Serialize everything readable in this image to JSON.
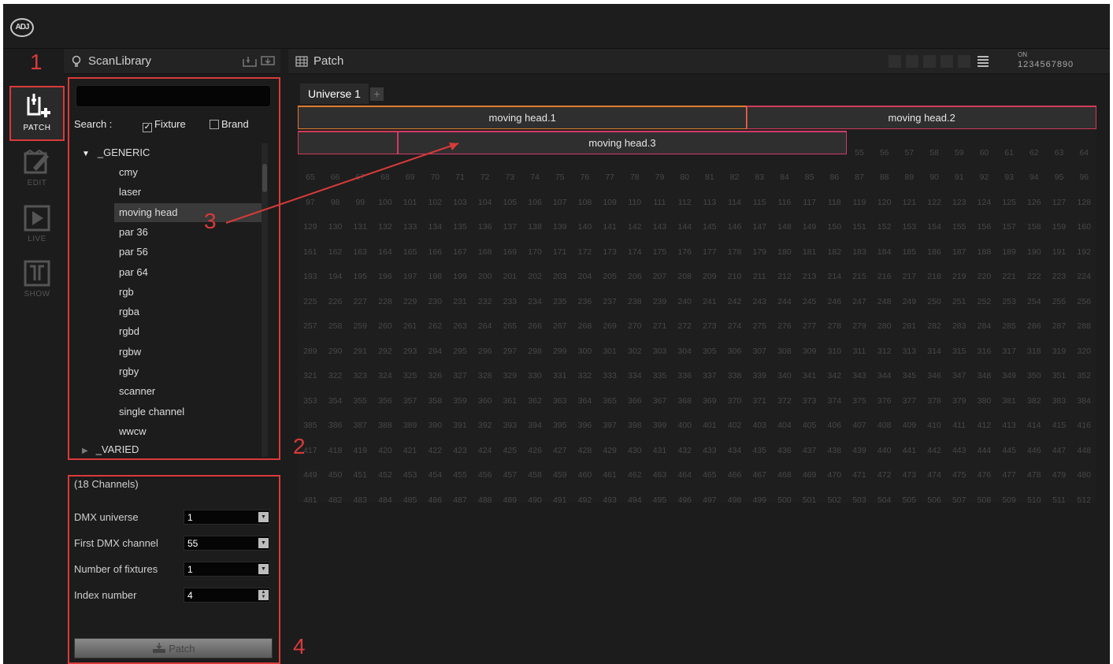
{
  "app": {
    "logo_text": "ADJ"
  },
  "nav": [
    {
      "id": "patch",
      "label": "PATCH",
      "icon": "patch-icon",
      "active": true
    },
    {
      "id": "edit",
      "label": "EDIT",
      "icon": "edit-icon",
      "active": false
    },
    {
      "id": "live",
      "label": "LIVE",
      "icon": "play-icon",
      "active": false
    },
    {
      "id": "show",
      "label": "SHOW",
      "icon": "show-icon",
      "active": false
    }
  ],
  "library": {
    "title": "ScanLibrary",
    "search_label": "Search :",
    "search_value": "",
    "filter_fixture": "Fixture",
    "filter_fixture_checked": true,
    "filter_brand": "Brand",
    "filter_brand_checked": false,
    "tree": {
      "generic_label": "_GENERIC",
      "generic_items": [
        "cmy",
        "laser",
        "moving head",
        "par 36",
        "par 56",
        "par 64",
        "rgb",
        "rgba",
        "rgbd",
        "rgbw",
        "rgby",
        "scanner",
        "single channel",
        "wwcw"
      ],
      "selected": "moving head",
      "varied_label": "_VARIED"
    }
  },
  "properties": {
    "channels": "(18 Channels)",
    "dmx_universe_label": "DMX universe",
    "dmx_universe_value": "1",
    "first_channel_label": "First DMX channel",
    "first_channel_value": "55",
    "num_fixtures_label": "Number of fixtures",
    "num_fixtures_value": "1",
    "index_label": "Index number",
    "index_value": "4",
    "patch_button": "Patch"
  },
  "patch_panel": {
    "title": "Patch",
    "universe_tab": "Universe 1",
    "add_tab": "+",
    "status_top": "ON",
    "status_bottom": "1234567890",
    "fixtures": [
      {
        "name": "moving head.1",
        "start": 1,
        "channels": 18,
        "color": "#e07a2e"
      },
      {
        "name": "moving head.2",
        "start": 19,
        "channels": 18,
        "color": "#d23a5a"
      },
      {
        "name": "moving head.3",
        "start": 37,
        "channels": 18,
        "color": "#d23a6a"
      }
    ],
    "dmx_total": 512,
    "columns": 32
  },
  "annotations": [
    "1",
    "2",
    "3",
    "4"
  ],
  "colors": {
    "highlight": "#d93a3a",
    "background": "#1c1c1c"
  }
}
